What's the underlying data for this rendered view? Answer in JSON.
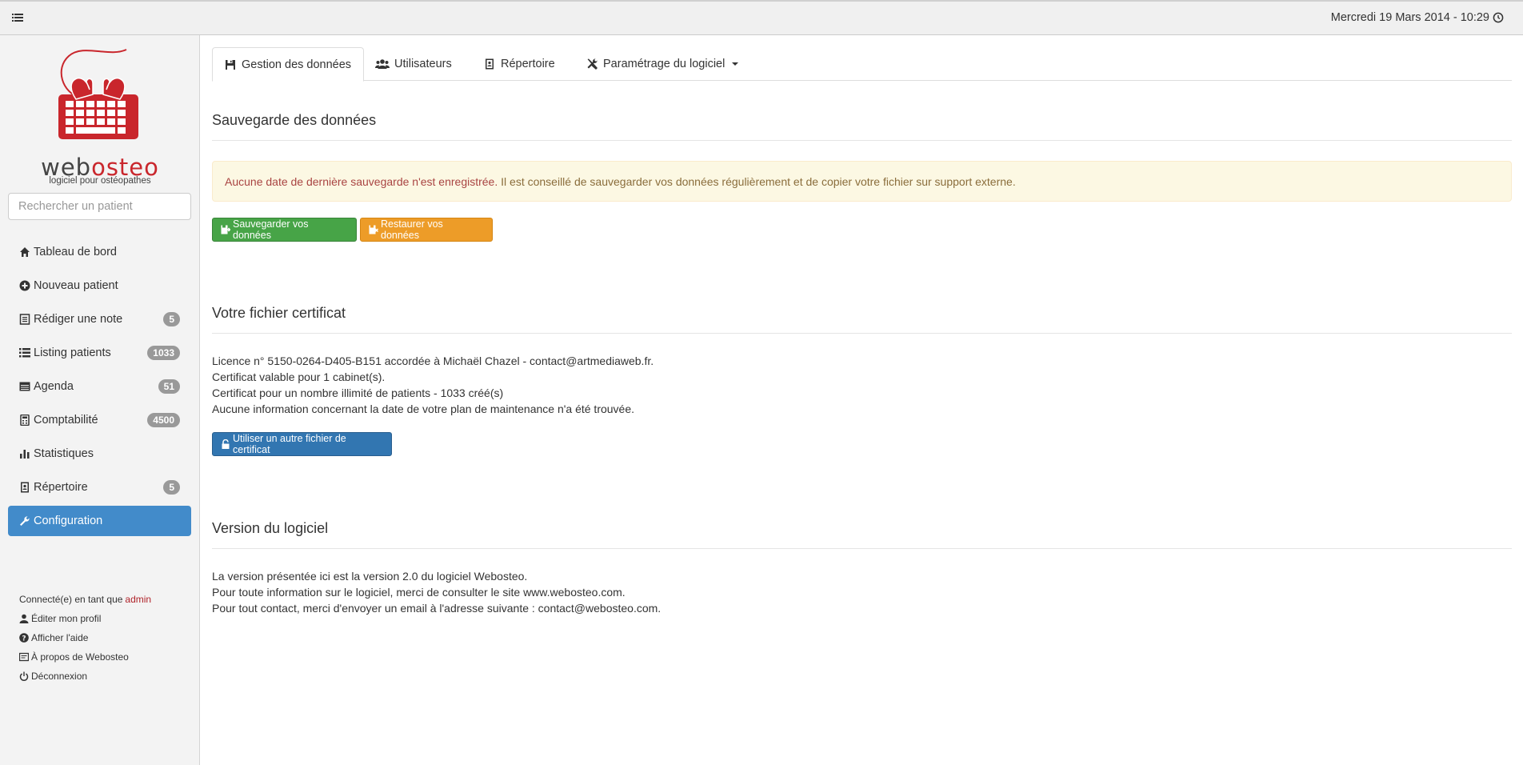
{
  "topbar": {
    "date": "Mercredi 19 Mars 2014 - 10:29"
  },
  "logo": {
    "word_part1": "web",
    "word_part2": "osteo",
    "tagline": "logiciel pour ostéopathes"
  },
  "search": {
    "placeholder": "Rechercher un patient"
  },
  "sidebar": {
    "items": [
      {
        "label": "Tableau de bord",
        "icon": "home-icon",
        "badge": ""
      },
      {
        "label": "Nouveau patient",
        "icon": "plus-circle-icon",
        "badge": ""
      },
      {
        "label": "Rédiger une note",
        "icon": "note-icon",
        "badge": "5"
      },
      {
        "label": "Listing patients",
        "icon": "list-icon",
        "badge": "1033"
      },
      {
        "label": "Agenda",
        "icon": "calendar-icon",
        "badge": "51"
      },
      {
        "label": "Comptabilité",
        "icon": "calculator-icon",
        "badge": "4500"
      },
      {
        "label": "Statistiques",
        "icon": "stats-icon",
        "badge": ""
      },
      {
        "label": "Répertoire",
        "icon": "address-book-icon",
        "badge": "5"
      },
      {
        "label": "Configuration",
        "icon": "wrench-icon",
        "badge": ""
      }
    ],
    "active_index": 8
  },
  "user": {
    "connected_prefix": "Connecté(e) en tant que",
    "username": "admin",
    "links": [
      {
        "label": "Éditer mon profil",
        "icon": "user-icon"
      },
      {
        "label": "Afficher l'aide",
        "icon": "help-icon"
      },
      {
        "label": "À propos de Webosteo",
        "icon": "info-card-icon"
      },
      {
        "label": "Déconnexion",
        "icon": "power-icon"
      }
    ]
  },
  "tabs": [
    {
      "label": "Gestion des données",
      "icon": "floppy-icon"
    },
    {
      "label": "Utilisateurs",
      "icon": "users-icon"
    },
    {
      "label": "Répertoire",
      "icon": "address-book-icon"
    },
    {
      "label": "Paramétrage du logiciel",
      "icon": "tools-icon"
    }
  ],
  "backup": {
    "title": "Sauvegarde des données",
    "alert_strong": "Aucune date de dernière sauvegarde n'est enregistrée.",
    "alert_text": " Il est conseillé de sauvegarder vos données régulièrement et de copier votre fichier sur support externe.",
    "save_label": "Sauvegarder vos données",
    "restore_label": "Restaurer vos données"
  },
  "certificate": {
    "title": "Votre fichier certificat",
    "lines": [
      "Licence n° 5150-0264-D405-B151 accordée à Michaël Chazel - contact@artmediaweb.fr.",
      "Certificat valable pour 1 cabinet(s).",
      "Certificat pour un nombre illimité de patients - 1033 créé(s)",
      "Aucune information concernant la date de votre plan de maintenance n'a été trouvée."
    ],
    "button_label": "Utiliser un autre fichier de certificat"
  },
  "version": {
    "title": "Version du logiciel",
    "lines": [
      "La version présentée ici est la version 2.0 du logiciel Webosteo.",
      "Pour toute information sur le logiciel, merci de consulter le site www.webosteo.com.",
      "Pour tout contact, merci d'envoyer un email à l'adresse suivante : contact@webosteo.com."
    ]
  },
  "colors": {
    "brand_red": "#c9262c",
    "active_blue": "#428bca",
    "success_green": "#47a447",
    "warning_orange": "#ed9c28",
    "primary_blue": "#3276b1"
  }
}
